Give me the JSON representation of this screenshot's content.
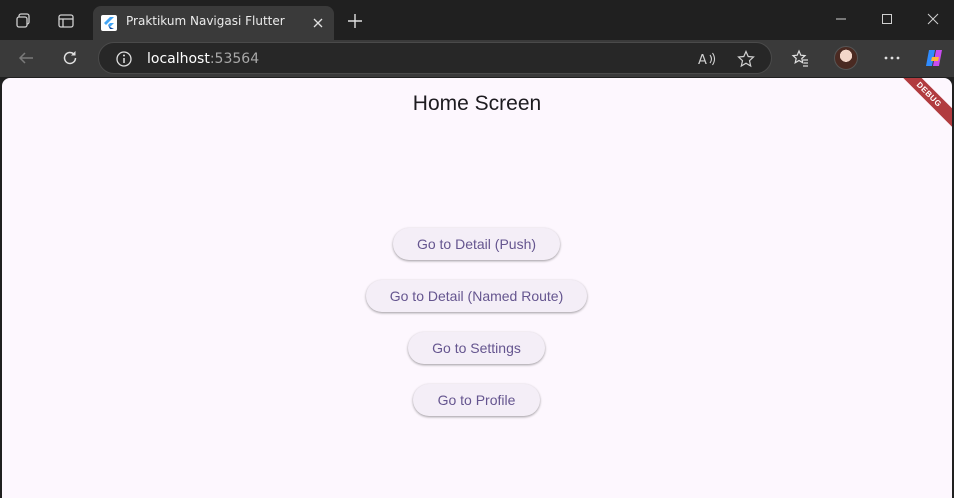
{
  "browser": {
    "tab": {
      "title": "Praktikum Navigasi Flutter",
      "favicon": "flutter-logo-icon"
    },
    "address": {
      "host": "localhost",
      "port": ":53564"
    },
    "icons": {
      "workspaces": "workspaces-icon",
      "tab_actions": "tab-actions-icon",
      "new_tab": "plus-icon",
      "back": "back-arrow-icon",
      "refresh": "refresh-icon",
      "site_info": "info-icon",
      "read_aloud": "read-aloud-icon",
      "favorite": "star-icon",
      "favorites": "favorites-icon",
      "profile": "avatar",
      "more": "more-icon",
      "copilot": "copilot-icon",
      "minimize": "minimize-icon",
      "maximize": "maximize-icon",
      "close": "close-icon"
    }
  },
  "app": {
    "title": "Home Screen",
    "debug_banner": "DEBUG",
    "buttons": [
      {
        "label": "Go to Detail (Push)"
      },
      {
        "label": "Go to Detail (Named Route)"
      },
      {
        "label": "Go to Settings"
      },
      {
        "label": "Go to Profile"
      }
    ],
    "colors": {
      "background": "#fdf7fe",
      "button_bg": "#f4eef7",
      "button_text": "#65558f",
      "title_text": "#1d1b20",
      "debug_ribbon": "#b13b3f"
    }
  }
}
